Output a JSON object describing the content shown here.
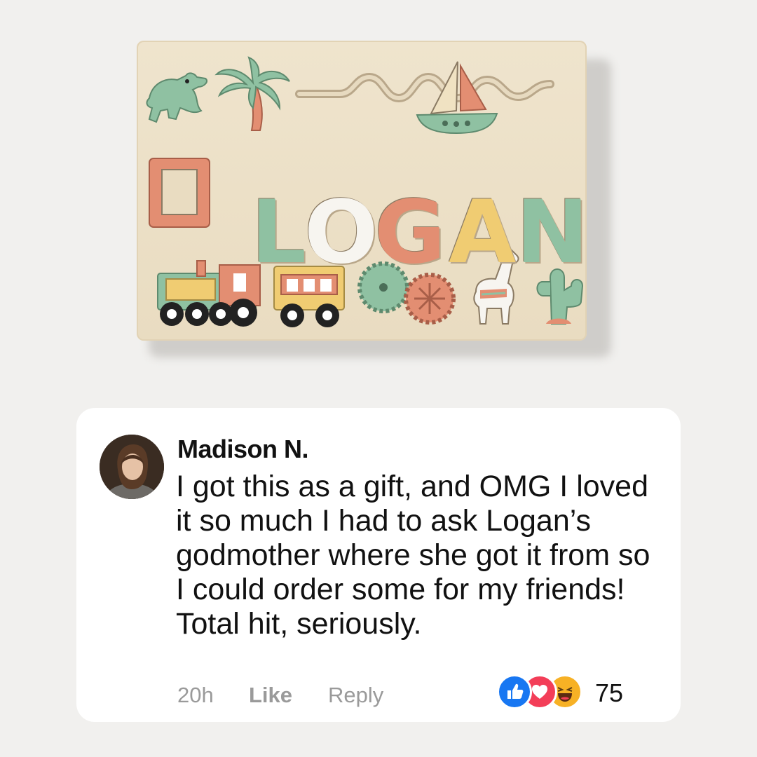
{
  "product": {
    "name_letters": [
      "L",
      "O",
      "G",
      "A",
      "N"
    ],
    "letter_colors": [
      "#8fc1a2",
      "#f7f5f0",
      "#e38e72",
      "#f0cc72",
      "#8fc1a2"
    ]
  },
  "comment": {
    "author": "Madison N.",
    "text": "I got this as a gift, and OMG I loved it so much I had to ask Logan’s godmother where she got it from so I could order some for my friends! Total hit, seriously.",
    "time": "20h",
    "like_label": "Like",
    "reply_label": "Reply",
    "reactions": [
      "like-icon",
      "love-icon",
      "haha-icon"
    ],
    "reaction_count": "75"
  }
}
